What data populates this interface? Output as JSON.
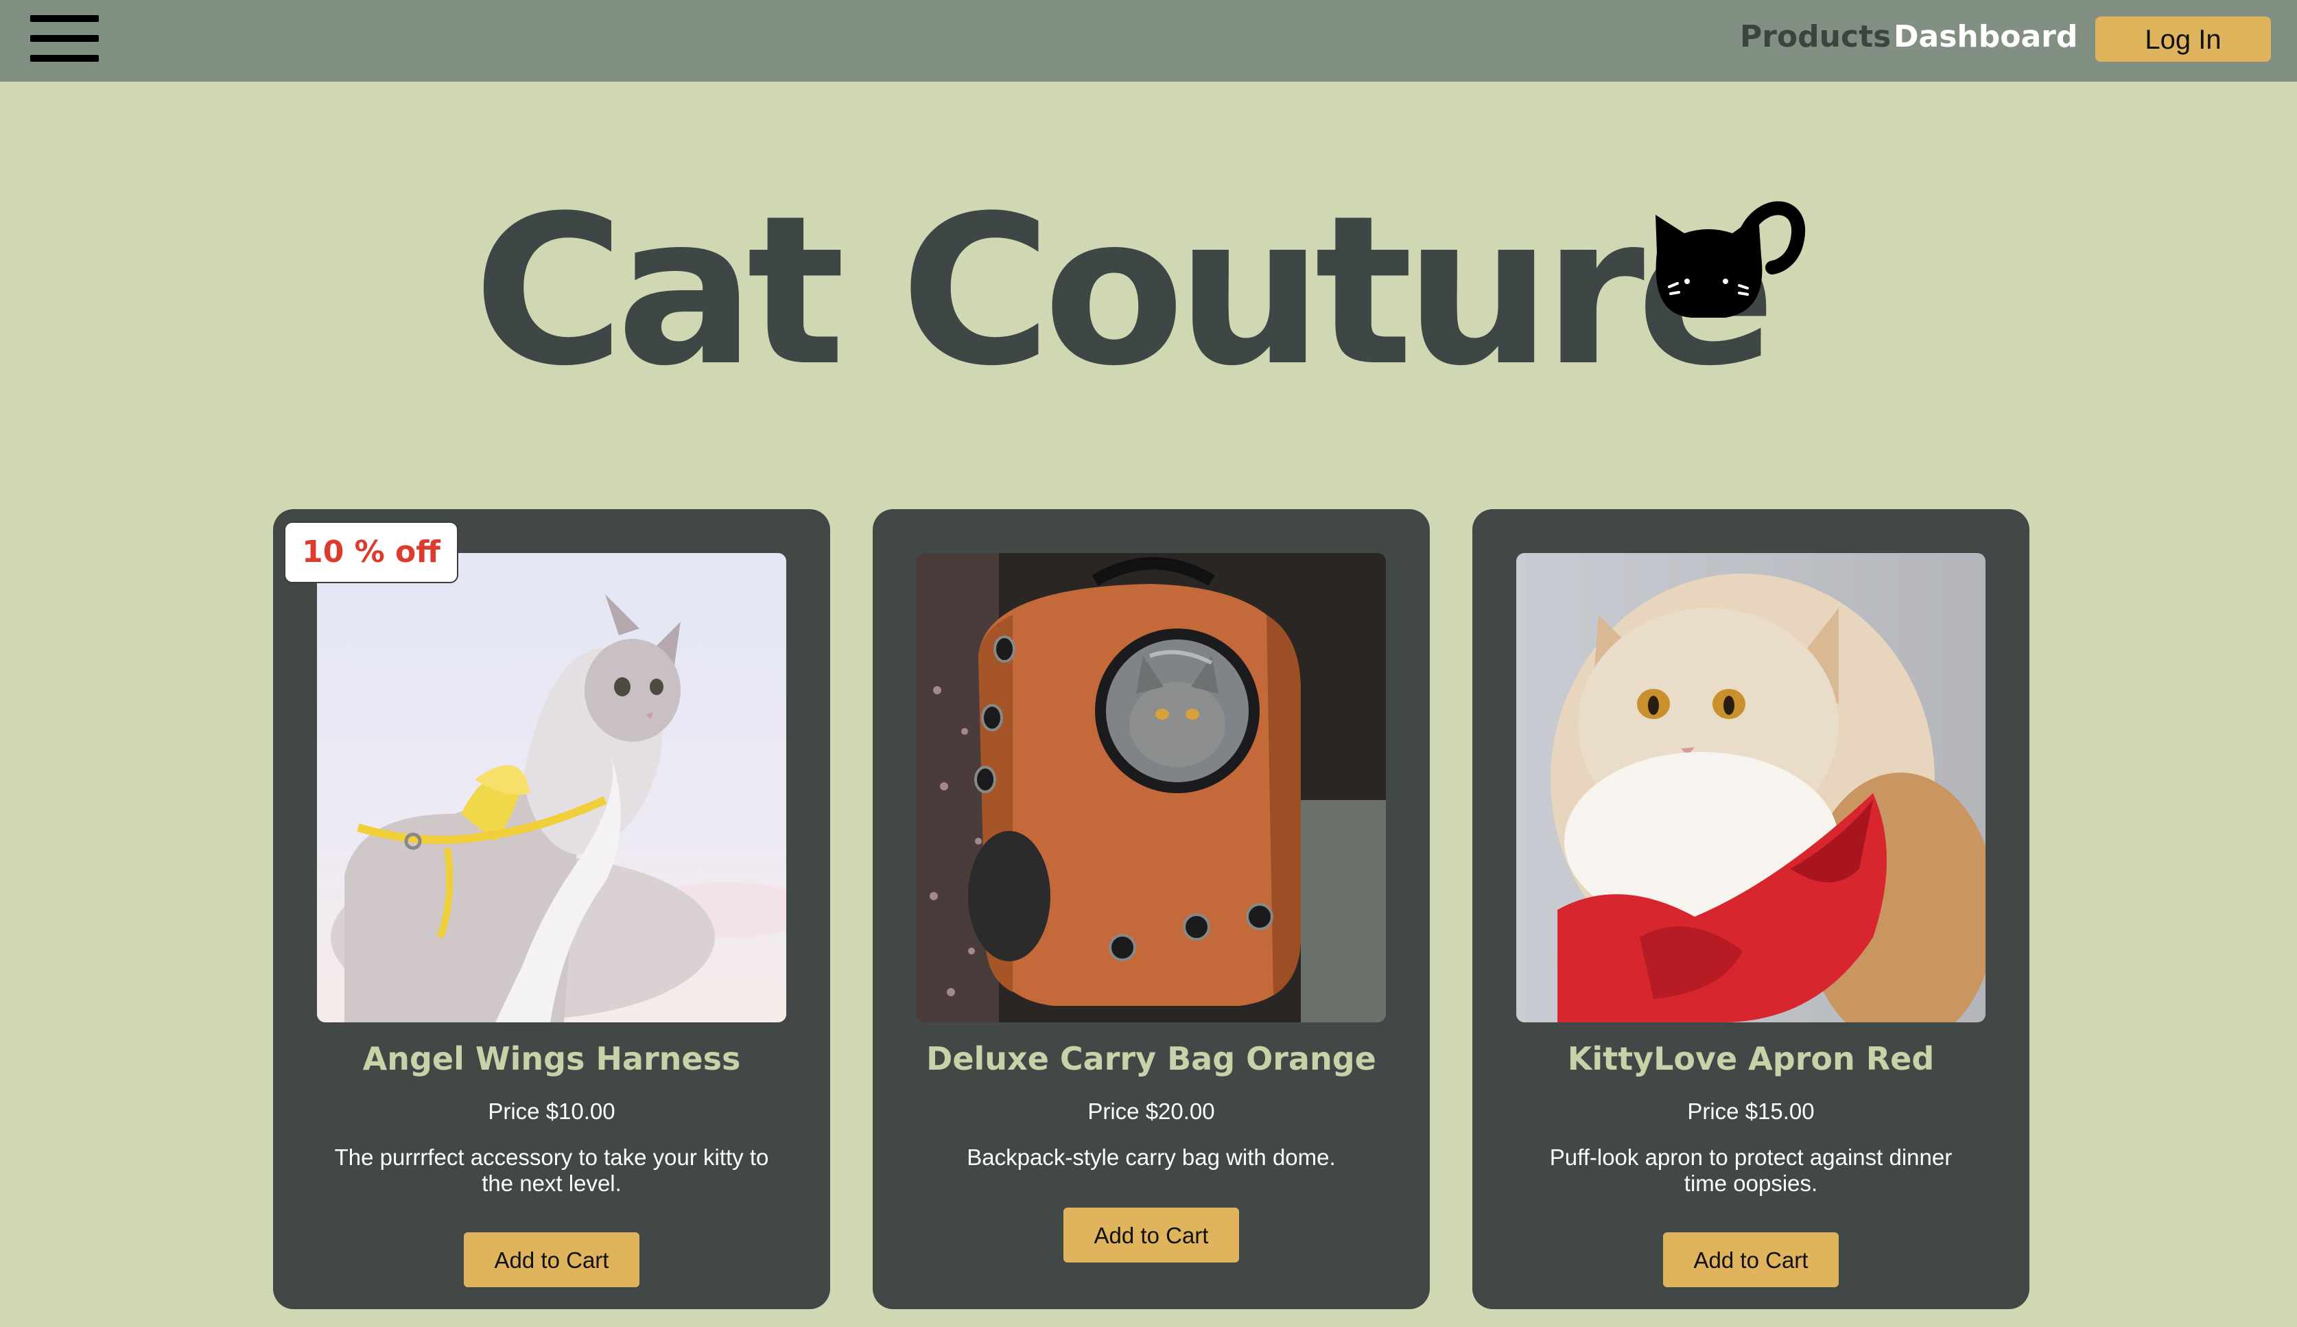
{
  "nav": {
    "products_label": "Products",
    "dashboard_label": "Dashboard",
    "login_label": "Log In"
  },
  "hero": {
    "title": "Cat Couture"
  },
  "products": [
    {
      "name": "Angel Wings Harness",
      "price": "Price $10.00",
      "description": "The purrrfect accessory to take your kitty to the next level.",
      "button_label": "Add to Cart",
      "badge": "10 % off"
    },
    {
      "name": "Deluxe Carry Bag Orange",
      "price": "Price $20.00",
      "description": "Backpack-style carry bag with dome.",
      "button_label": "Add to Cart"
    },
    {
      "name": "KittyLove Apron Red",
      "price": "Price $15.00",
      "description": "Puff-look apron to protect against dinner time oopsies.",
      "button_label": "Add to Cart"
    }
  ],
  "colors": {
    "page_bg": "#d0d8b3",
    "topbar_bg": "#829084",
    "card_bg": "#414846",
    "accent_button": "#e0b35d",
    "card_title": "#c7d2a9",
    "badge_text": "#dc3b2e"
  }
}
